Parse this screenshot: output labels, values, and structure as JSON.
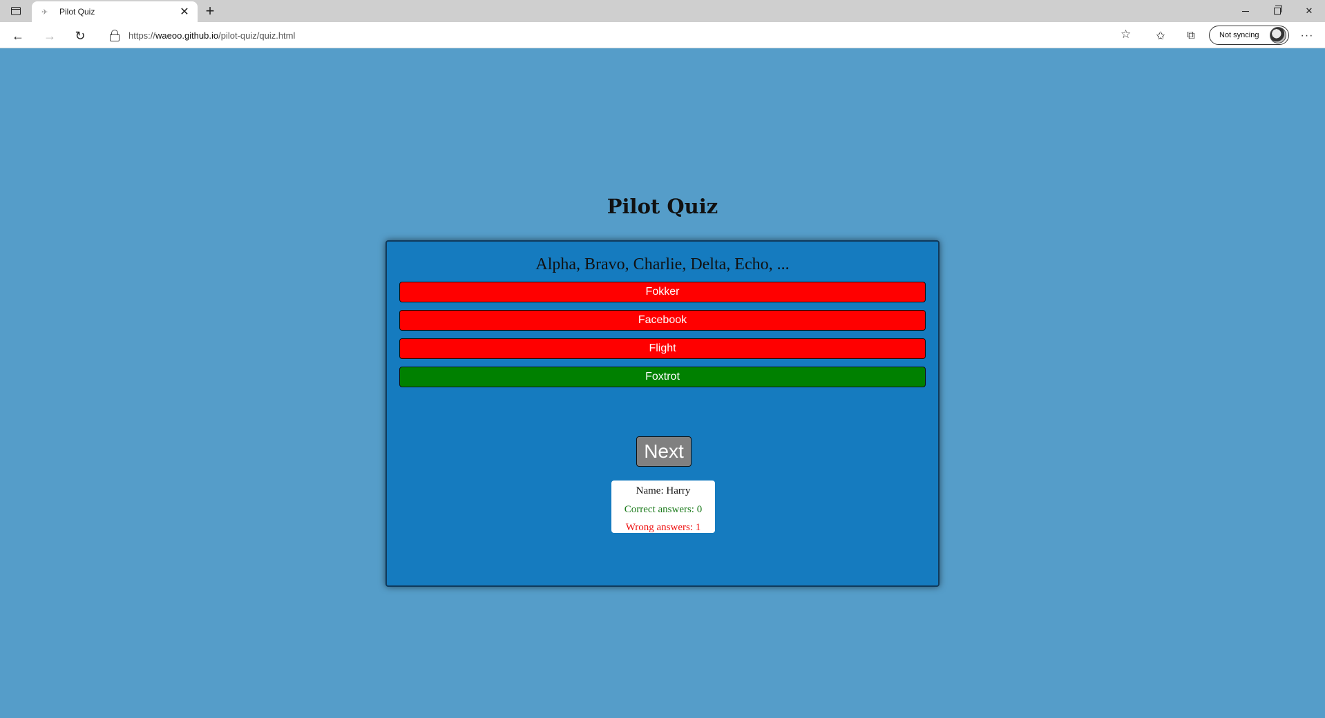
{
  "browser": {
    "tab_title": "Pilot Quiz",
    "new_tab_symbol": "+",
    "url_prefix": "https://",
    "url_host": "waeoo.github.io",
    "url_path": "/pilot-quiz/quiz.html",
    "profile_label": "Not syncing",
    "icons": [
      "sidebar-icon",
      "favicon",
      "close-icon",
      "plus-icon",
      "minimize-icon",
      "restore-icon",
      "back-arrow-icon",
      "forward-arrow-icon",
      "reload-icon",
      "lock-icon",
      "favorite-add-icon",
      "favorites-icon",
      "collections-icon",
      "avatar",
      "more-icon"
    ]
  },
  "page": {
    "title": "Pilot Quiz",
    "background_color": "#559dc9",
    "card_color": "#157bbf"
  },
  "quiz": {
    "question": "Alpha, Bravo, Charlie, Delta, Echo, ...",
    "answers": [
      {
        "label": "Fokker",
        "state": "wrong",
        "color": "#ff0000"
      },
      {
        "label": "Facebook",
        "state": "wrong",
        "color": "#ff0000"
      },
      {
        "label": "Flight",
        "state": "wrong",
        "color": "#ff0000"
      },
      {
        "label": "Foxtrot",
        "state": "correct",
        "color": "#008000"
      }
    ],
    "next_label": "Next"
  },
  "score": {
    "name_text": "Name: Harry",
    "correct_text": "Correct answers: 0",
    "wrong_text": "Wrong answers: 1",
    "correct_color": "#1a7a1a",
    "wrong_color": "#ee1111"
  }
}
